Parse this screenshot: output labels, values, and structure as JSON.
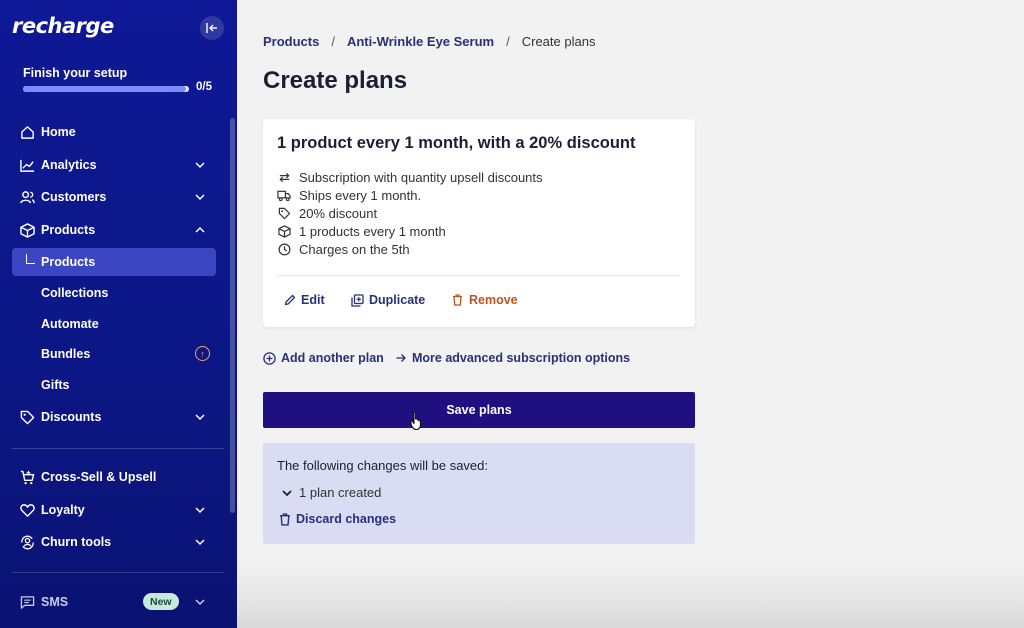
{
  "sidebar": {
    "logo": "recharge",
    "setup": {
      "title": "Finish your setup",
      "count": "0/5",
      "progress": 0.98
    },
    "nav": {
      "home": "Home",
      "analytics": "Analytics",
      "customers": "Customers",
      "products": "Products",
      "products_sub": "Products",
      "collections": "Collections",
      "automate": "Automate",
      "bundles": "Bundles",
      "gifts": "Gifts",
      "discounts": "Discounts",
      "cross_sell": "Cross-Sell & Upsell",
      "loyalty": "Loyalty",
      "churn_tools": "Churn tools",
      "sms": "SMS",
      "sms_badge": "New"
    }
  },
  "breadcrumb": {
    "items": [
      "Products",
      "Anti-Wrinkle Eye Serum"
    ],
    "current": "Create plans",
    "separator": "/"
  },
  "page": {
    "title": "Create plans"
  },
  "plan_card": {
    "title": "1 product every 1 month, with a 20% discount",
    "features": [
      {
        "icon": "repeat-icon",
        "text": "Subscription with quantity upsell discounts"
      },
      {
        "icon": "truck-icon",
        "text": "Ships every 1 month."
      },
      {
        "icon": "tag-icon",
        "text": "20% discount"
      },
      {
        "icon": "box-icon",
        "text": "1 products every 1 month"
      },
      {
        "icon": "clock-icon",
        "text": "Charges on the 5th"
      }
    ],
    "actions": {
      "edit": "Edit",
      "duplicate": "Duplicate",
      "remove": "Remove"
    }
  },
  "links": {
    "add_plan": "Add another plan",
    "advanced": "More advanced subscription options"
  },
  "save_button": "Save plans",
  "changes": {
    "title": "The following changes will be saved:",
    "item": "1 plan created",
    "discard": "Discard changes"
  },
  "colors": {
    "sidebar_bg": "#0f1896",
    "primary_button": "#1f0f80",
    "link": "#2a2f7a",
    "remove": "#c0531f",
    "changes_bg": "#d9dcf3"
  }
}
